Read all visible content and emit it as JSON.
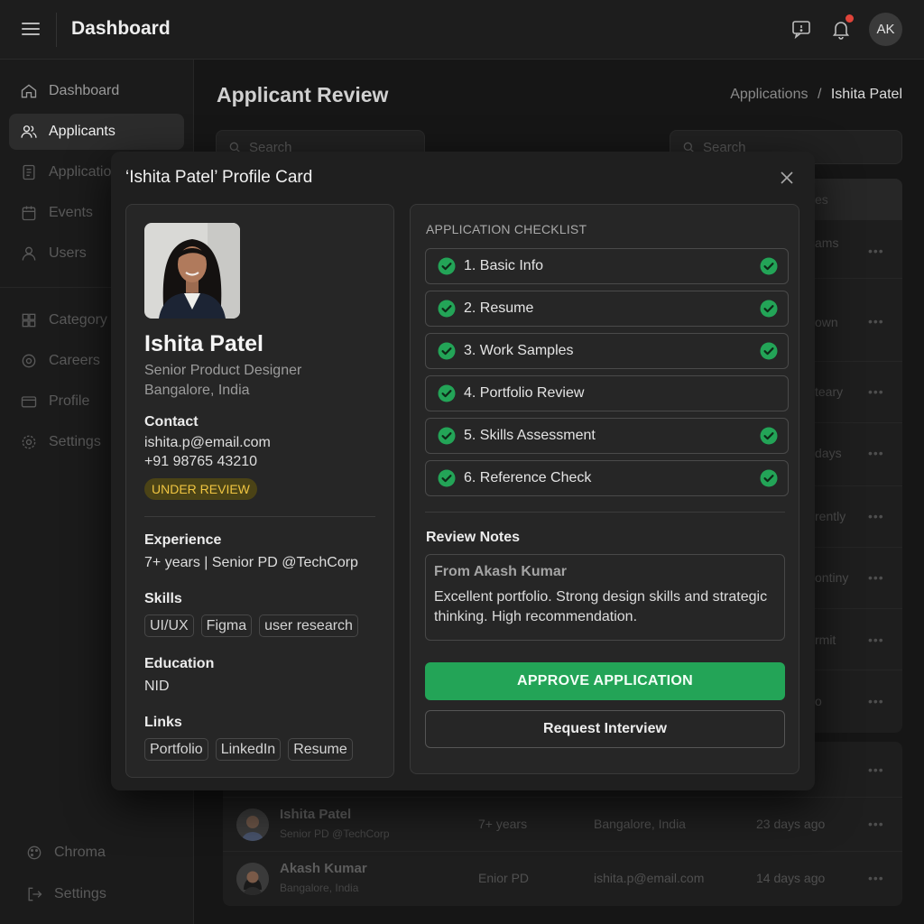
{
  "header": {
    "title": "Dashboard",
    "user_initials": "AK",
    "icons": [
      "menu-icon",
      "chat-icon",
      "bell-icon"
    ]
  },
  "sidebar": {
    "items": [
      {
        "label": "Dashboard",
        "icon": "home-icon"
      },
      {
        "label": "Applicants",
        "icon": "users-icon",
        "active": true
      },
      {
        "label": "Applicatio",
        "icon": "document-icon"
      },
      {
        "label": "Events",
        "icon": "calendar-icon"
      },
      {
        "label": "Users",
        "icon": "user-icon"
      },
      {
        "label": "Category",
        "icon": "grid-icon"
      },
      {
        "label": "Careers",
        "icon": "briefcase-icon"
      },
      {
        "label": "Profile",
        "icon": "profile-icon"
      },
      {
        "label": "Settings",
        "icon": "gear-icon"
      }
    ],
    "bottom_items": [
      {
        "label": "Chroma",
        "icon": "palette-icon"
      },
      {
        "label": "Settings",
        "icon": "logout-icon"
      }
    ]
  },
  "page": {
    "title": "Applicant Review",
    "breadcrumb": {
      "parent": "Applications",
      "separator": "/",
      "current": "Ishita Patel"
    },
    "search_placeholder_left": "Search",
    "search_placeholder_right": "Search"
  },
  "background_table": {
    "header_fragment": "es",
    "row_fragments": [
      "ams",
      "own",
      "teary",
      "days",
      "rently",
      "ontiny",
      "rmit",
      "o",
      "go"
    ],
    "rows": [
      {
        "name": "Ishita Patel",
        "subtitle": "Senior PD @TechCorp",
        "experience": "7+ years",
        "location": "Bangalore, India",
        "time": "23 days ago"
      },
      {
        "name": "Akash Kumar",
        "subtitle": "Bangalore, India",
        "experience": "Enior PD",
        "location": "ishita.p@email.com",
        "time": "14 days ago"
      }
    ],
    "more": "•••"
  },
  "modal": {
    "title": "‘Ishita Patel’ Profile Card",
    "profile": {
      "name": "Ishita Patel",
      "role": "Senior Product Designer",
      "location": "Bangalore, India",
      "contact_heading": "Contact",
      "email": "ishita.p@email.com",
      "phone": "+91 98765 43210",
      "status": "UNDER REVIEW",
      "experience_heading": "Experience",
      "experience": "7+ years | Senior PD @TechCorp",
      "skills_heading": "Skills",
      "skills": [
        "UI/UX",
        "Figma",
        "user research"
      ],
      "education_heading": "Education",
      "education": "NID",
      "links_heading": "Links",
      "links": [
        "Portfolio",
        "LinkedIn",
        "Resume"
      ]
    },
    "checklist": {
      "heading": "APPLICATION CHECKLIST",
      "items": [
        {
          "label": "1. Basic Info",
          "done": true
        },
        {
          "label": "2. Resume",
          "done": true
        },
        {
          "label": "3. Work Samples",
          "done": true
        },
        {
          "label": "4. Portfolio Review",
          "done": false
        },
        {
          "label": "5. Skills Assessment",
          "done": true
        },
        {
          "label": "6. Reference Check",
          "done": true
        }
      ]
    },
    "notes": {
      "heading": "Review Notes",
      "from": "From Akash Kumar",
      "text": "Excellent portfolio. Strong design skills and strategic thinking. High recommendation."
    },
    "approve_label": "APPROVE APPLICATION",
    "interview_label": "Request Interview"
  },
  "colors": {
    "accent_green": "#23a457",
    "status_yellow": "#f0c541",
    "notification_red": "#e0443a"
  }
}
